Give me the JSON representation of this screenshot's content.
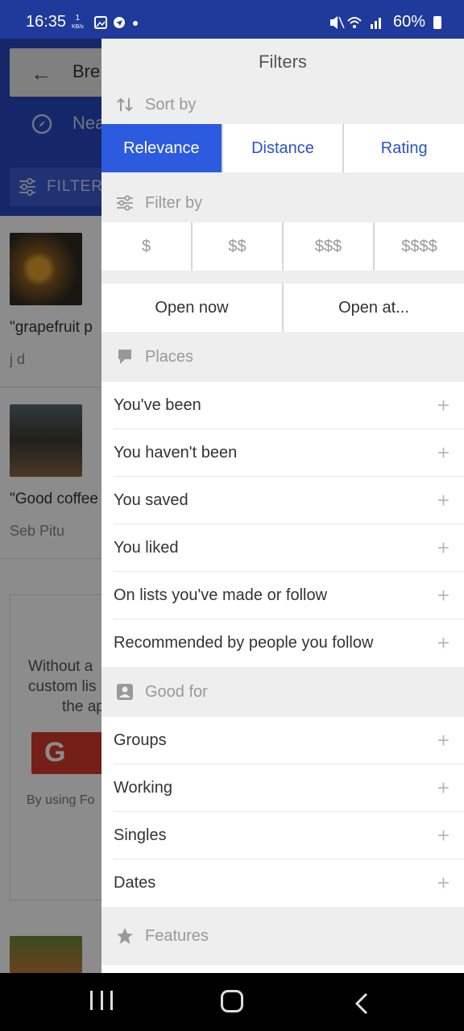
{
  "status_bar": {
    "time": "16:35",
    "speed_value": "1",
    "speed_unit": "KB/s",
    "battery": "60%"
  },
  "background": {
    "search_text": "Bre",
    "near_text": "Nea",
    "filters_label": "FILTERS",
    "items": [
      {
        "title": "\"grapefruit p",
        "author": "j d"
      },
      {
        "title": "\"Good coffee",
        "author": "Seb Pitu"
      }
    ],
    "card_text": [
      "Without a",
      "custom lis",
      "the ap"
    ],
    "card_footer": "By using Fo",
    "google_letter": "G"
  },
  "drawer": {
    "title": "Filters",
    "sort": {
      "header": "Sort by",
      "options": [
        "Relevance",
        "Distance",
        "Rating"
      ],
      "selected": "Relevance"
    },
    "filter": {
      "header": "Filter by",
      "prices": [
        "$",
        "$$",
        "$$$",
        "$$$$"
      ],
      "open_options": [
        "Open now",
        "Open at..."
      ]
    },
    "places": {
      "header": "Places",
      "items": [
        "You've been",
        "You haven't been",
        "You saved",
        "You liked",
        "On lists you've made or follow",
        "Recommended by people you follow"
      ]
    },
    "good_for": {
      "header": "Good for",
      "items": [
        "Groups",
        "Working",
        "Singles",
        "Dates"
      ]
    },
    "features": {
      "header": "Features"
    }
  },
  "colors": {
    "accent": "#2c5be0",
    "status_bar": "#1f3a9b",
    "header_bg": "#2748c0"
  }
}
